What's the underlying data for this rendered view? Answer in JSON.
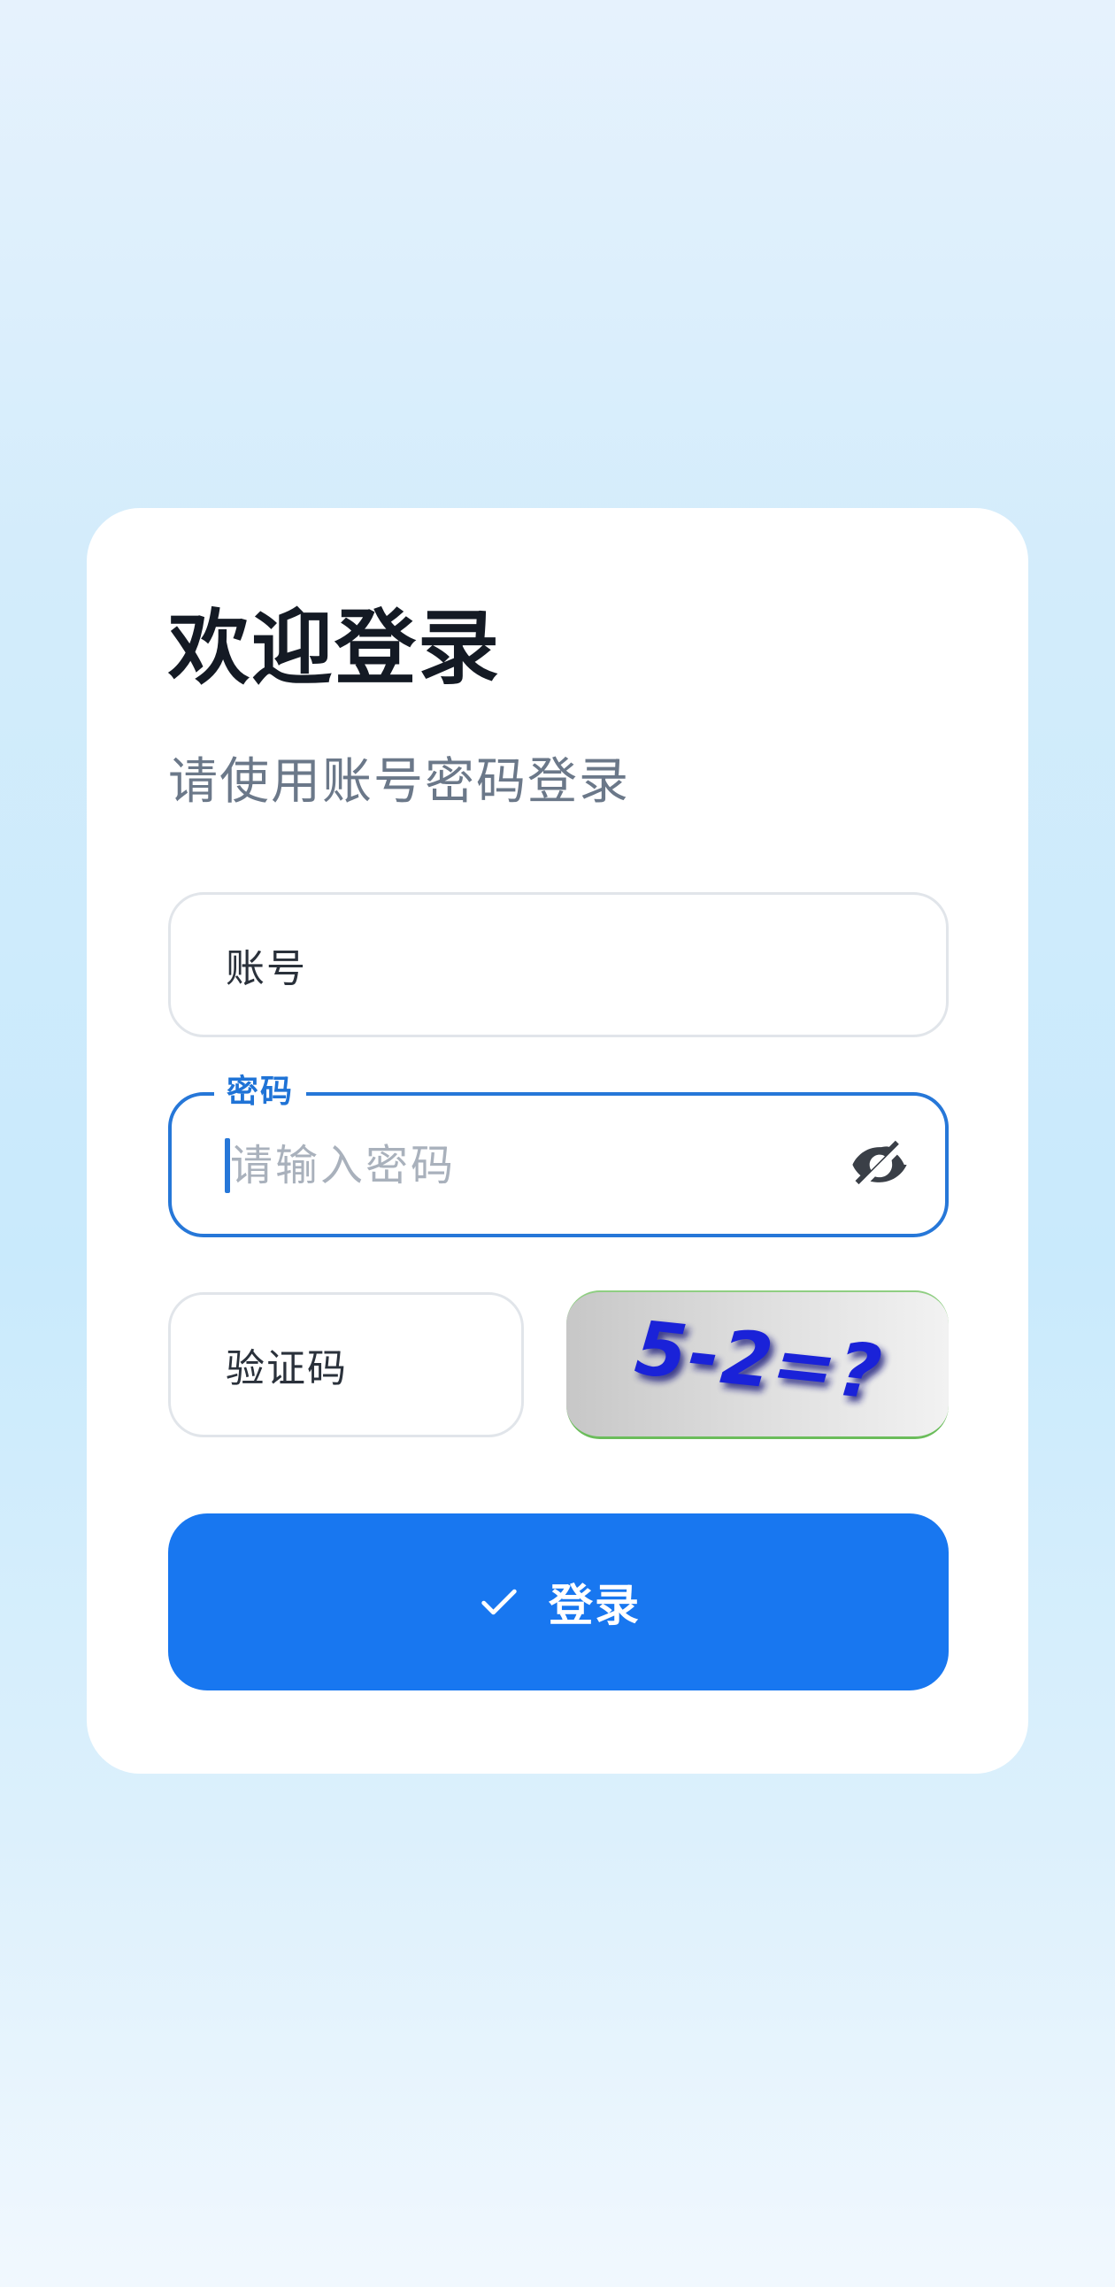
{
  "login": {
    "title": "欢迎登录",
    "subtitle": "请使用账号密码登录",
    "account_label": "账号",
    "password_label": "密码",
    "password_placeholder": "请输入密码",
    "password_value": "",
    "captcha_label": "验证码",
    "captcha_text": "5-2=?",
    "submit_label": "登录"
  },
  "icons": {
    "password_toggle": "eye-off-icon",
    "submit": "check-icon"
  },
  "colors": {
    "primary": "#1877f0",
    "focus_border": "#2677d8",
    "captcha_text": "#1a22d8"
  }
}
